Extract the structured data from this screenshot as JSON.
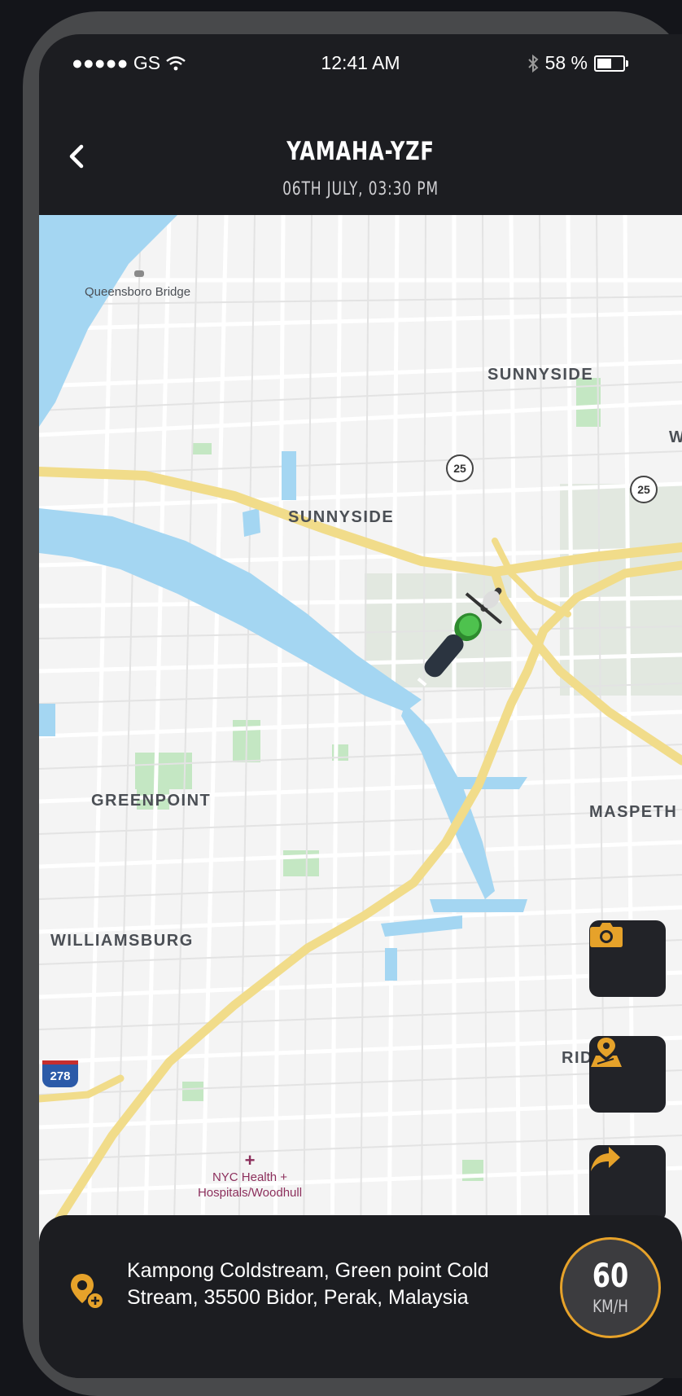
{
  "status_bar": {
    "carrier": "●●●●● GS",
    "time": "12:41 AM",
    "battery": "58 %",
    "battery_level": 0.58
  },
  "header": {
    "title": "YAMAHA-YZF",
    "subtitle": "06TH JULY, 03:30 PM"
  },
  "map": {
    "labels": {
      "sunnyside_1": "SUNNYSIDE",
      "sunnyside_2": "SUNNYSIDE",
      "greenpoint": "GREENPOINT",
      "williamsburg": "WILLIAMSBURG",
      "maspeth": "MASPETH",
      "ridgewood_partial": "RID",
      "queensboro": "Queensboro Bridge",
      "hospital": "NYC Health +\nHospitals/Woodhull",
      "edge_partial": "W"
    },
    "route_shields": {
      "a": "25",
      "b": "25",
      "interstate": "278"
    }
  },
  "actions": {
    "camera": "camera-icon",
    "location": "map-pin-icon",
    "share": "share-arrow-icon"
  },
  "location": {
    "address": "Kampong Coldstream, Green point Cold Stream, 35500 Bidor, Perak, Malaysia"
  },
  "speed": {
    "value": "60",
    "unit": "KM/H"
  },
  "colors": {
    "accent": "#e6a22a",
    "panel": "#1c1d21",
    "water": "#a4d6f2",
    "highway": "#f1dc8a",
    "park": "#c4e7c3"
  }
}
